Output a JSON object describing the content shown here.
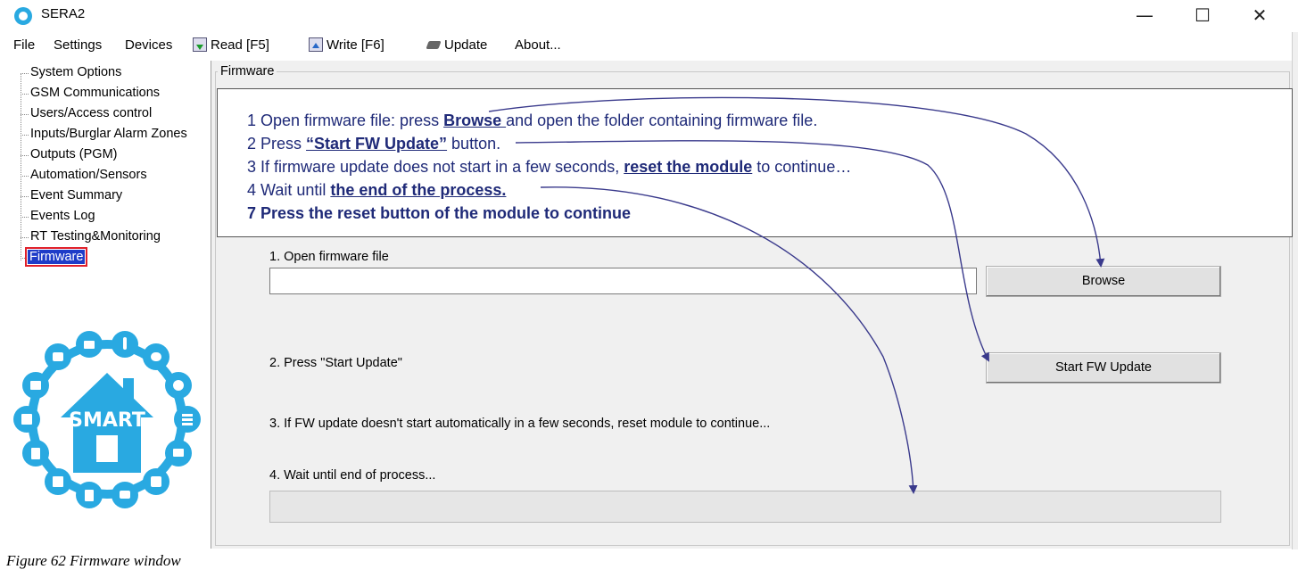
{
  "window": {
    "title": "SERA2",
    "controls": {
      "minimize": "—",
      "maximize": "☐",
      "close": "✕"
    }
  },
  "menu": {
    "file": "File",
    "settings": "Settings",
    "devices": "Devices",
    "read": "Read [F5]",
    "write": "Write [F6]",
    "update": "Update",
    "about": "About..."
  },
  "sidebar": {
    "items": [
      "System Options",
      "GSM Communications",
      "Users/Access control",
      "Inputs/Burglar Alarm Zones",
      "Outputs (PGM)",
      "Automation/Sensors",
      "Event Summary",
      "Events Log",
      "RT Testing&Monitoring",
      "Firmware"
    ],
    "selected": "Firmware",
    "logo_text": "SMART"
  },
  "firmware": {
    "group_label": "Firmware",
    "step1_label": "1. Open firmware file",
    "file_value": "",
    "browse_label": "Browse",
    "step2_label": "2. Press \"Start Update\"",
    "start_label": "Start FW Update",
    "step3_label": "3. If FW update doesn't start automatically in a few seconds, reset module to continue...",
    "step4_label": "4. Wait until end of process...",
    "progress": 0
  },
  "callout": {
    "line1": {
      "pre": "1 Open firmware file: press ",
      "key": "Browse ",
      "post": "and open the folder containing firmware file."
    },
    "line2": {
      "pre": "2 Press ",
      "key": "“Start FW Update”",
      "post": " button."
    },
    "line3": {
      "pre": "3 If firmware update does not start in a few seconds, ",
      "key": "reset the module",
      "post": " to continue…"
    },
    "line4": {
      "pre": "4 Wait until ",
      "key": "the end of the process.",
      "post": ""
    },
    "line5": {
      "text": "7 Press the reset button of the module to continue"
    }
  },
  "colors": {
    "accent": "#29a9e1",
    "callout_text": "#1f2a78",
    "selection": "#1e3cc8",
    "highlight_border": "#e0202a",
    "arrow": "#3a3a8c"
  },
  "caption": "Figure 62 Firmware window"
}
